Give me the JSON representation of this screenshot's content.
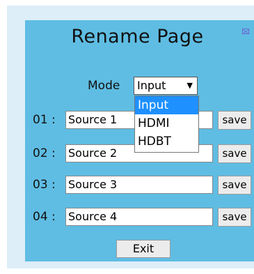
{
  "title": "Rename Page",
  "mode": {
    "label": "Mode",
    "selected": "Input",
    "options": [
      "Input",
      "HDMI",
      "HDBT"
    ]
  },
  "rows": [
    {
      "label": "01 :",
      "value": "Source 1",
      "save": "save"
    },
    {
      "label": "02 :",
      "value": "Source 2",
      "save": "save"
    },
    {
      "label": "03 :",
      "value": "Source 3",
      "save": "save"
    },
    {
      "label": "04 :",
      "value": "Source 4",
      "save": "save"
    }
  ],
  "exit_label": "Exit",
  "colors": {
    "panel": "#5fbde3",
    "frame": "#ddeef9",
    "highlight": "#1e90ff"
  }
}
